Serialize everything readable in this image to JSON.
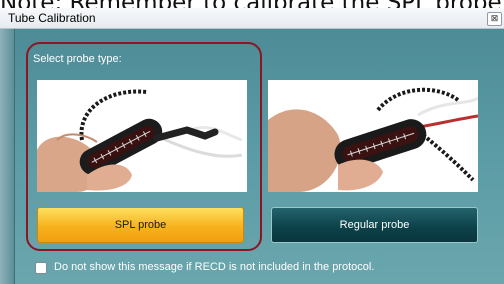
{
  "header_banner": {
    "text": "Note: Remember to calibrate the SPL probe"
  },
  "window": {
    "title": "Tube Calibration",
    "close_glyph": "⊠"
  },
  "dialog": {
    "prompt": "Select probe type:",
    "options": [
      {
        "label": "SPL probe",
        "selected": true,
        "image": "spl-probe-photo"
      },
      {
        "label": "Regular probe",
        "selected": false,
        "image": "regular-probe-photo"
      }
    ],
    "checkbox": {
      "label": "Do not show this message if RECD is not included in the protocol.",
      "checked": false
    }
  },
  "colors": {
    "panel_bg": "#5c9ca6",
    "selected_button": "#f7b21d",
    "unselected_button": "#0c4048",
    "highlight_border": "#8b1624"
  }
}
